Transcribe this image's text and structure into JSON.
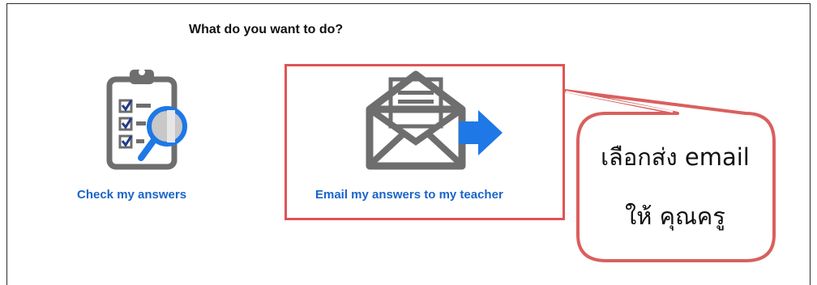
{
  "prompt": {
    "title": "What do you want to do?"
  },
  "options": [
    {
      "label": "Check my answers",
      "icon": "clipboard-checklist-magnifier-icon"
    },
    {
      "label": "Email my answers to my teacher",
      "icon": "envelope-send-arrow-icon",
      "highlighted": true
    }
  ],
  "callout": {
    "line1": "เลือกส่ง email",
    "line2": "ให้ คุณครู"
  },
  "colors": {
    "link": "#1a64c8",
    "icon_gray": "#6e6e6e",
    "accent_blue": "#1e78e6",
    "highlight_red": "#e05454"
  }
}
